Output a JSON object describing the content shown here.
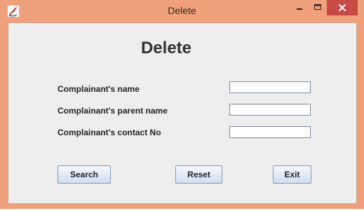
{
  "window": {
    "title": "Delete",
    "colors": {
      "frame": "#f0a07a",
      "close": "#c74a44",
      "client": "#eeeeee"
    },
    "icons": {
      "app": "java-cup-icon",
      "minimize": "minimize-icon",
      "maximize": "maximize-icon",
      "close": "close-icon"
    }
  },
  "form": {
    "heading": "Delete",
    "fields": [
      {
        "label": "Complainant's name",
        "value": ""
      },
      {
        "label": "Complainant's parent name",
        "value": ""
      },
      {
        "label": "Complainant's contact No",
        "value": ""
      }
    ]
  },
  "buttons": {
    "search": "Search",
    "reset": "Reset",
    "exit": "Exit"
  }
}
